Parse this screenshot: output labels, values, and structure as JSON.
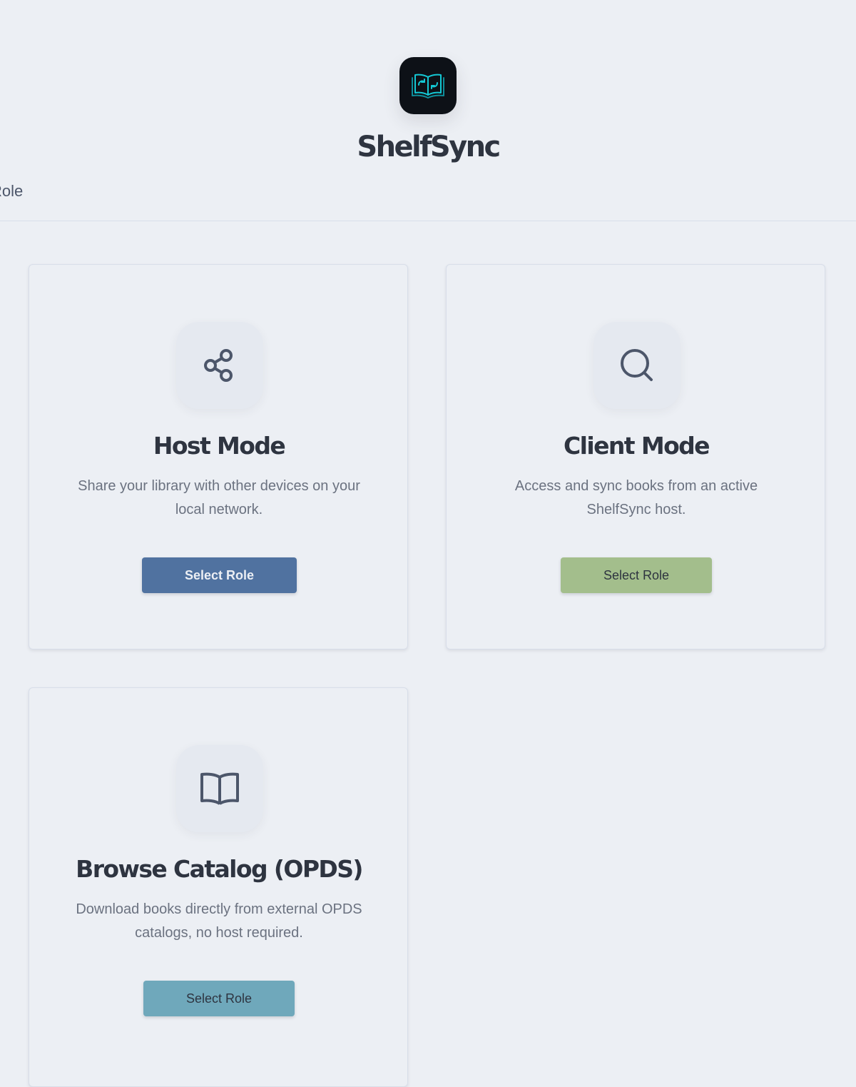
{
  "app": {
    "name": "ShelfSync",
    "logo_icon": "book-sync-icon",
    "accent_color": "#14c8d4"
  },
  "page": {
    "cut_off_title": "Role"
  },
  "roles": [
    {
      "title": "Host Mode",
      "description": "Share your library with other devices on your local network.",
      "button_label": "Select Role",
      "icon": "share-icon",
      "button_color": "#5072a0"
    },
    {
      "title": "Client Mode",
      "description": "Access and sync books from an active ShelfSync host.",
      "button_label": "Select Role",
      "icon": "search-icon",
      "button_color": "#a3be8c"
    },
    {
      "title": "Browse Catalog (OPDS)",
      "description": "Download books directly from external OPDS catalogs, no host required.",
      "button_label": "Select Role",
      "icon": "open-book-icon",
      "button_color": "#6fa8bb"
    }
  ]
}
